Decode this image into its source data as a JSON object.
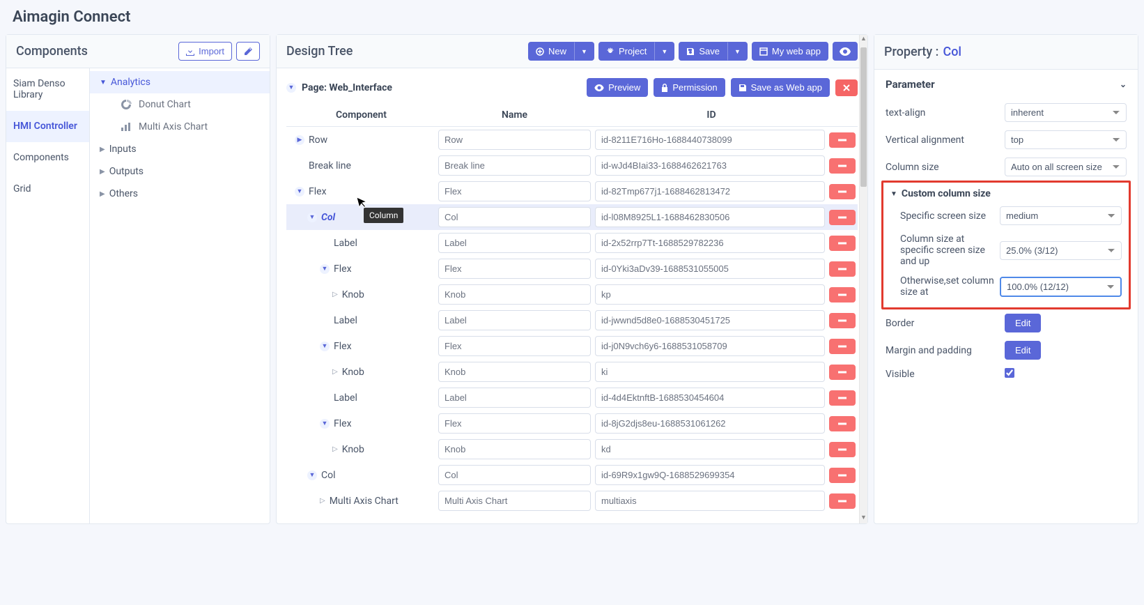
{
  "app": {
    "title": "Aimagin Connect"
  },
  "left": {
    "header": "Components",
    "import_btn": "Import",
    "libs": [
      "Siam Denso Library",
      "HMI Controller",
      "Components",
      "Grid"
    ],
    "active_lib": 1,
    "categories": [
      {
        "label": "Analytics",
        "expanded": true,
        "children": [
          "Donut Chart",
          "Multi Axis Chart"
        ]
      },
      {
        "label": "Inputs"
      },
      {
        "label": "Outputs"
      },
      {
        "label": "Others"
      }
    ]
  },
  "center": {
    "header": "Design Tree",
    "toolbar": {
      "new": "New",
      "project": "Project",
      "save": "Save",
      "mywebapp": "My web app"
    },
    "page": {
      "label": "Page: Web_Interface",
      "preview": "Preview",
      "permission": "Permission",
      "saveas": "Save as Web app"
    },
    "columns": {
      "component": "Component",
      "name": "Name",
      "id": "ID"
    },
    "tooltip": "Column",
    "rows": [
      {
        "indent": 0,
        "exp": "closed",
        "comp": "Row",
        "name": "Row",
        "id": "id-8211E716Ho-1688440738099",
        "selected": false
      },
      {
        "indent": 0,
        "exp": "none",
        "comp": "Break line",
        "name": "Break line",
        "id": "id-wJd4BIai33-1688462621763"
      },
      {
        "indent": 0,
        "exp": "open",
        "comp": "Flex",
        "name": "Flex",
        "id": "id-82Tmp677j1-1688462813472"
      },
      {
        "indent": 1,
        "exp": "open",
        "comp": "Col",
        "name": "Col",
        "id": "id-l08M8925L1-1688462830506",
        "selected": true
      },
      {
        "indent": 2,
        "exp": "none",
        "comp": "Label",
        "name": "Label",
        "id": "id-2x52rrp7Tt-1688529782236"
      },
      {
        "indent": 2,
        "exp": "open",
        "comp": "Flex",
        "name": "Flex",
        "id": "id-0Yki3aDv39-1688531055005"
      },
      {
        "indent": 3,
        "exp": "tri",
        "comp": "Knob",
        "name": "Knob",
        "id": "kp"
      },
      {
        "indent": 2,
        "exp": "none",
        "comp": "Label",
        "name": "Label",
        "id": "id-jwwnd5d8e0-1688530451725"
      },
      {
        "indent": 2,
        "exp": "open",
        "comp": "Flex",
        "name": "Flex",
        "id": "id-j0N9vch6y6-1688531058709"
      },
      {
        "indent": 3,
        "exp": "tri",
        "comp": "Knob",
        "name": "Knob",
        "id": "ki"
      },
      {
        "indent": 2,
        "exp": "none",
        "comp": "Label",
        "name": "Label",
        "id": "id-4d4EktnftB-1688530454604"
      },
      {
        "indent": 2,
        "exp": "open",
        "comp": "Flex",
        "name": "Flex",
        "id": "id-8jG2djs8eu-1688531061262"
      },
      {
        "indent": 3,
        "exp": "tri",
        "comp": "Knob",
        "name": "Knob",
        "id": "kd"
      },
      {
        "indent": 1,
        "exp": "open",
        "comp": "Col",
        "name": "Col",
        "id": "id-69R9x1gw9Q-1688529699354"
      },
      {
        "indent": 2,
        "exp": "tri",
        "comp": "Multi Axis Chart",
        "name": "Multi Axis Chart",
        "id": "multiaxis"
      }
    ]
  },
  "right": {
    "header": "Property :",
    "sel": "Col",
    "param_hdr": "Parameter",
    "props": {
      "textalign": {
        "label": "text-align",
        "value": "inherent"
      },
      "valign": {
        "label": "Vertical alignment",
        "value": "top"
      },
      "colsize": {
        "label": "Column size",
        "value": "Auto on all screen size"
      },
      "customhdr": "Custom column size",
      "screensize": {
        "label": "Specific screen size",
        "value": "medium"
      },
      "csup": {
        "label": "Column size at specific screen size and up",
        "value": "25.0% (3/12)"
      },
      "otherwise": {
        "label": "Otherwise,set column size at",
        "value": "100.0% (12/12)"
      },
      "border": {
        "label": "Border",
        "btn": "Edit"
      },
      "margin": {
        "label": "Margin and padding",
        "btn": "Edit"
      },
      "visible": {
        "label": "Visible",
        "checked": true
      }
    }
  }
}
